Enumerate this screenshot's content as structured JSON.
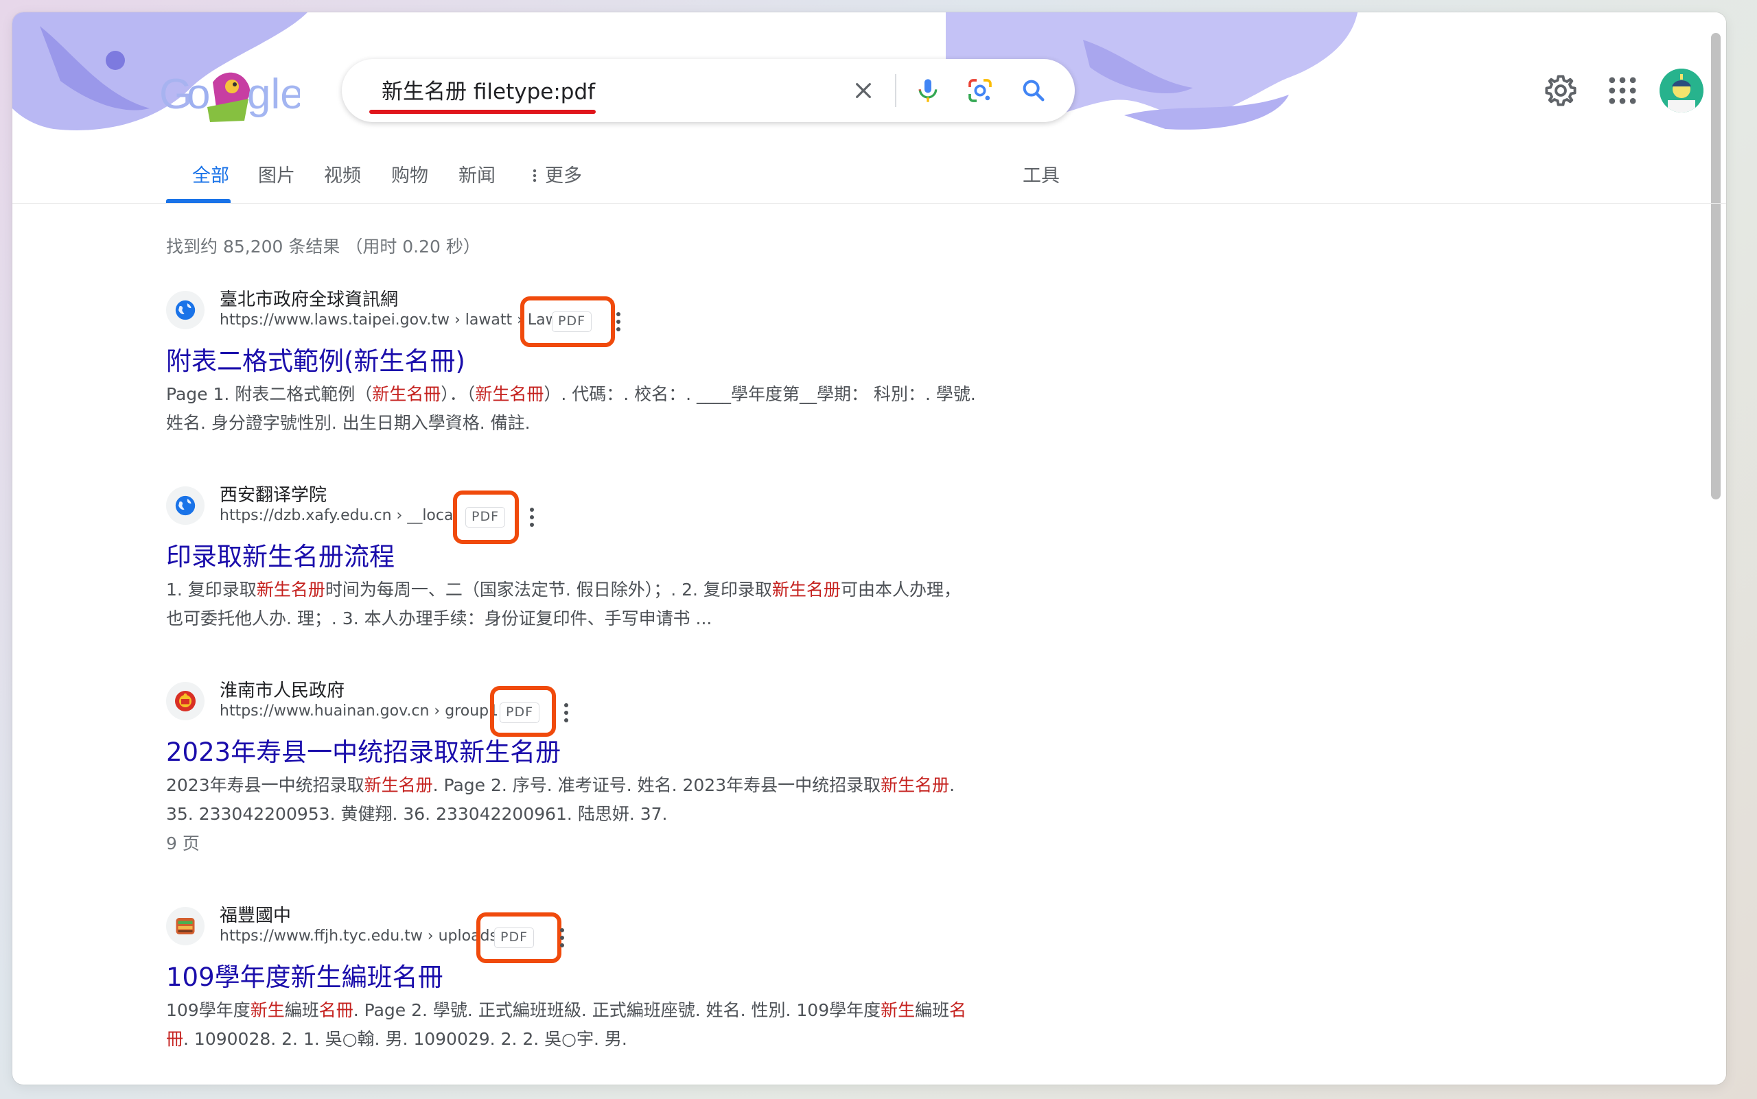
{
  "search": {
    "query": "新生名册 filetype:pdf"
  },
  "tabs": [
    {
      "label": "全部",
      "active": true
    },
    {
      "label": "图片"
    },
    {
      "label": "视频"
    },
    {
      "label": "购物"
    },
    {
      "label": "新闻"
    },
    {
      "label": "更多"
    }
  ],
  "tools_label": "工具",
  "result_stats": "找到约 85,200 条结果 （用时 0.20 秒）",
  "results": [
    {
      "site_name": "臺北市政府全球資訊網",
      "url": "https://www.laws.taipei.gov.tw › lawatt › Law",
      "badge": "PDF",
      "title": "附表二格式範例(新生名冊)",
      "snippet": [
        {
          "t": "Page 1. 附表二格式範例（"
        },
        {
          "t": "新生名冊",
          "em": true
        },
        {
          "t": "）．（"
        },
        {
          "t": "新生名冊",
          "em": true
        },
        {
          "t": "）. 代碼：. 校名：. ____學年度第__學期： 科別：. 學號. 姓名. 身分證字號性別. 出生日期入學資格. 備註."
        }
      ]
    },
    {
      "site_name": "西安翻译学院",
      "url": "https://dzb.xafy.edu.cn › __local",
      "badge": "PDF",
      "title": "印录取新生名册流程",
      "snippet": [
        {
          "t": "1. 复印录取"
        },
        {
          "t": "新生名册",
          "em": true
        },
        {
          "t": "时间为每周一、二（国家法定节. 假日除外）；. 2. 复印录取"
        },
        {
          "t": "新生名册",
          "em": true
        },
        {
          "t": "可由本人办理，也可委托他人办. 理；. 3. 本人办理手续：身份证复印件、手写申请书 ..."
        }
      ]
    },
    {
      "site_name": "淮南市人民政府",
      "url": "https://www.huainan.gov.cn › group1",
      "badge": "PDF",
      "title": "2023年寿县一中统招录取新生名册",
      "snippet": [
        {
          "t": "2023年寿县一中统招录取"
        },
        {
          "t": "新生名册",
          "em": true
        },
        {
          "t": ". Page 2. 序号. 准考证号. 姓名. 2023年寿县一中统招录取"
        },
        {
          "t": "新生名册",
          "em": true
        },
        {
          "t": ". 35. 233042200953. 黄健翔. 36. 233042200961. 陆思妍. 37."
        }
      ],
      "pages_note": "9 页"
    },
    {
      "site_name": "福豐國中",
      "url": "https://www.ffjh.tyc.edu.tw › uploads",
      "badge": "PDF",
      "title": "109學年度新生編班名冊",
      "snippet": [
        {
          "t": "109學年度"
        },
        {
          "t": "新生",
          "em": true
        },
        {
          "t": "編班"
        },
        {
          "t": "名冊",
          "em": true
        },
        {
          "t": ". Page 2. 學號. 正式編班班級. 正式編班座號. 姓名. 性別. 109學年度"
        },
        {
          "t": "新生",
          "em": true
        },
        {
          "t": "編班"
        },
        {
          "t": "名冊",
          "em": true
        },
        {
          "t": ". 1090028. 2. 1. 吳○翰. 男. 1090029. 2. 2. 吳○宇. 男."
        }
      ]
    }
  ],
  "colors": {
    "link": "#1a0dab",
    "accent": "#1a73e8",
    "highlight_term": "#c5221f",
    "annotation_box": "#f04a0c",
    "query_underline": "#e0151b"
  },
  "icons": [
    "google-doodle-logo",
    "clear-icon",
    "mic-icon",
    "lens-icon",
    "search-icon",
    "settings-gear-icon",
    "apps-grid-icon",
    "avatar",
    "globe-icon",
    "emblem-icon",
    "school-icon",
    "more-vert-icon"
  ]
}
